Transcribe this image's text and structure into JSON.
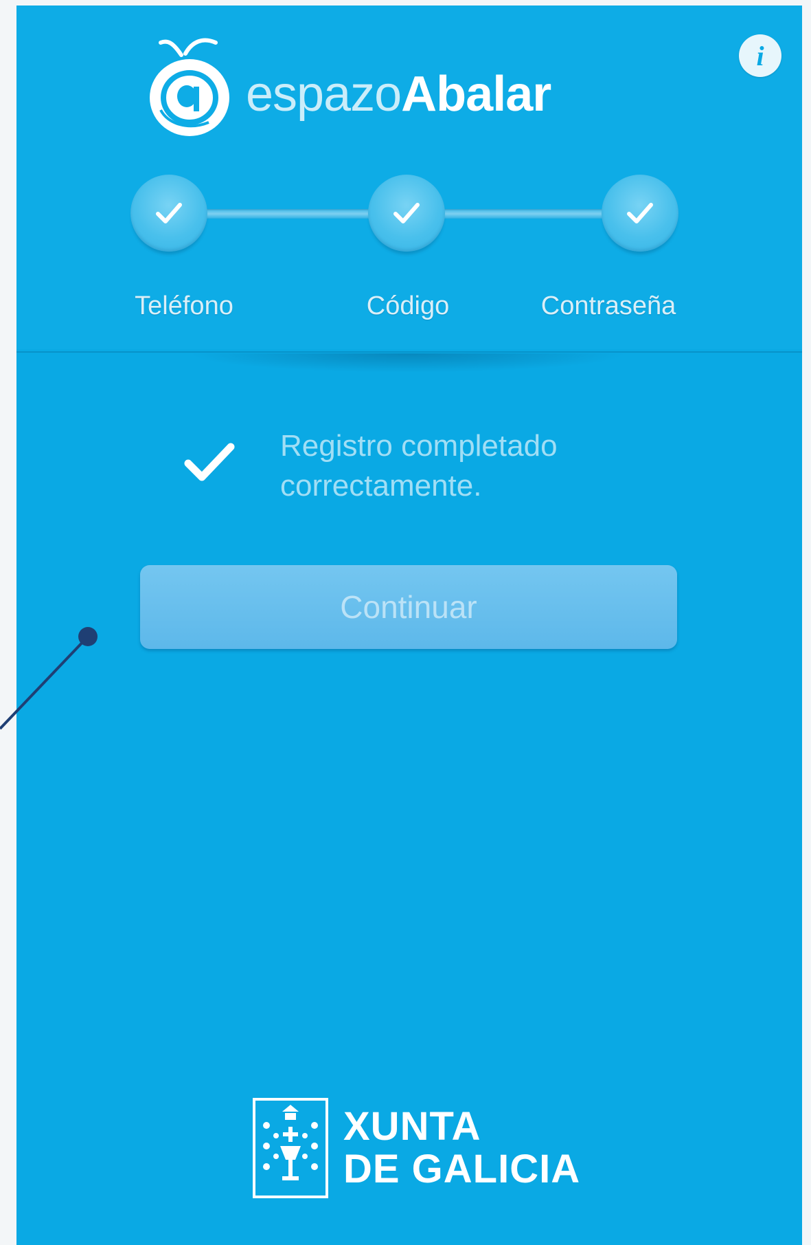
{
  "app": {
    "brand_light": "espazo",
    "brand_bold": "Abalar",
    "info_icon": "info-icon"
  },
  "stepper": {
    "steps": [
      {
        "label": "Teléfono",
        "state": "completed"
      },
      {
        "label": "Código",
        "state": "completed"
      },
      {
        "label": "Contraseña",
        "state": "completed"
      }
    ]
  },
  "status": {
    "message": "Registro completado correctamente.",
    "icon": "check-icon"
  },
  "actions": {
    "continue_label": "Continuar",
    "continue_enabled": false
  },
  "footer": {
    "line1": "XUNTA",
    "line2": "DE GALICIA"
  },
  "colors": {
    "background": "#0aa9e4",
    "header": "#0eace6",
    "button": "#69bfee",
    "text": "#ffffff"
  }
}
